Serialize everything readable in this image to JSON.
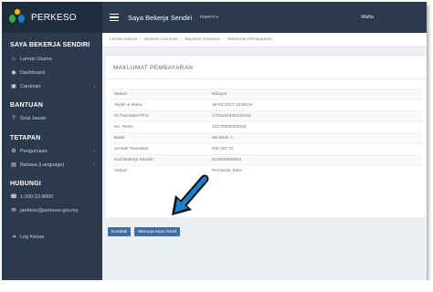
{
  "brand": {
    "name": "PERKESO"
  },
  "topbar": {
    "title": "Saya Bekerja Sendiri",
    "language": "TEMPAT ▾",
    "user": "Wafia"
  },
  "sidebar": {
    "section_main": "SAYA BEKERJA SENDIRI",
    "items_main": [
      {
        "label": "Laman Utama",
        "icon": "home-icon",
        "glyph": "⌂"
      },
      {
        "label": "Dashboard",
        "icon": "dashboard-icon",
        "glyph": "◉"
      },
      {
        "label": "Caruman",
        "icon": "caruman-icon",
        "glyph": "▣",
        "chevron": "‹"
      }
    ],
    "section_help": "BANTUAN",
    "items_help": [
      {
        "label": "Soal Jawab",
        "icon": "question-icon",
        "glyph": "?"
      }
    ],
    "section_settings": "TETAPAN",
    "items_settings": [
      {
        "label": "Pengurusan",
        "icon": "gear-icon",
        "glyph": "⚙",
        "chevron": "‹"
      },
      {
        "label": "Bahasa (Language)",
        "icon": "language-icon",
        "glyph": "▤",
        "chevron": "‹"
      }
    ],
    "section_contact": "HUBUNGI",
    "items_contact": [
      {
        "label": "1-300-22-8000",
        "icon": "phone-icon",
        "glyph": "☎"
      },
      {
        "label": "perkeso@perkeso.gov.my",
        "icon": "email-icon",
        "glyph": "✉"
      }
    ],
    "logout": {
      "label": "Log Keluar",
      "icon": "logout-icon",
      "glyph": "⇥"
    }
  },
  "breadcrumb": [
    "Laman Utama",
    "Senarai Caruman",
    "Bayaran Caruman",
    "Maklumat Pembayaran"
  ],
  "card": {
    "title": "MAKLUMAT PEMBAYARAN",
    "rows": [
      {
        "label": "Status:",
        "value": "Dibayar"
      },
      {
        "label": "Tarikh & Masa:",
        "value": "18-03-2017 18:58:04"
      },
      {
        "label": "ID Transaksi FPX:",
        "value": "1703181800120194"
      },
      {
        "label": "No. Resit:",
        "value": "23170000000026"
      },
      {
        "label": "Bank:",
        "value": "SB Bank A"
      },
      {
        "label": "Jumlah Transaksi:",
        "value": "RM 157.20"
      },
      {
        "label": "Kod Bekerja Sendiri:",
        "value": "B13000000024"
      },
      {
        "label": "Sektor:",
        "value": "Pemandu Teksi"
      }
    ]
  },
  "buttons": {
    "back": "Kembali",
    "receipt": "Memuat turun Resit"
  },
  "colors": {
    "sidebar": "#2b3a4d",
    "button": "#3c6ea8",
    "arrow": "#1e7fd0"
  }
}
